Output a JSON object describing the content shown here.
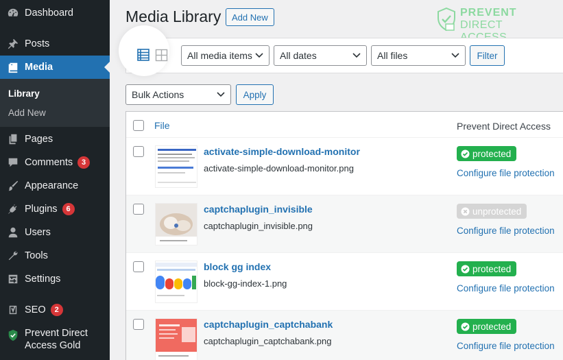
{
  "sidebar": {
    "items": [
      {
        "label": "Dashboard",
        "icon": "dashboard-icon"
      },
      {
        "label": "Posts",
        "icon": "pin-icon"
      },
      {
        "label": "Media",
        "icon": "media-icon",
        "active": true
      },
      {
        "label": "Pages",
        "icon": "pages-icon"
      },
      {
        "label": "Comments",
        "icon": "comment-icon",
        "badge": "3"
      },
      {
        "label": "Appearance",
        "icon": "brush-icon"
      },
      {
        "label": "Plugins",
        "icon": "plug-icon",
        "badge": "6"
      },
      {
        "label": "Users",
        "icon": "user-icon"
      },
      {
        "label": "Tools",
        "icon": "wrench-icon"
      },
      {
        "label": "Settings",
        "icon": "settings-icon"
      },
      {
        "label": "SEO",
        "icon": "yoast-icon",
        "badge": "2"
      },
      {
        "label_line1": "Prevent Direct",
        "label_line2": "Access Gold",
        "icon": "shield-icon"
      }
    ],
    "submenu": [
      {
        "label": "Library",
        "current": true
      },
      {
        "label": "Add New"
      }
    ]
  },
  "header": {
    "title": "Media Library",
    "add_new_label": "Add New",
    "brand_line1": "PREVENT",
    "brand_line2": "DIRECT ACCESS"
  },
  "filters": {
    "media_type": "All media items",
    "dates": "All dates",
    "files": "All files",
    "filter_button": "Filter",
    "bulk_actions": "Bulk Actions",
    "apply_button": "Apply"
  },
  "table": {
    "columns": {
      "file": "File",
      "pda": "Prevent Direct Access"
    },
    "rows": [
      {
        "title": "activate-simple-download-monitor",
        "filename": "activate-simple-download-monitor.png",
        "status": "protected",
        "link": "Configure file protection"
      },
      {
        "title": "captchaplugin_invisible",
        "filename": "captchaplugin_invisible.png",
        "status": "unprotected",
        "link": "Configure file protection"
      },
      {
        "title": "block gg index",
        "filename": "block-gg-index-1.png",
        "status": "protected",
        "link": "Configure file protection"
      },
      {
        "title": "captchaplugin_captchabank",
        "filename": "captchaplugin_captchabank.png",
        "status": "protected",
        "link": "Configure file protection"
      }
    ]
  },
  "colors": {
    "sidebar_bg": "#1d2327",
    "active_blue": "#2271b1",
    "protected_green": "#23b04e",
    "unprotected_gray": "#d5d5d5",
    "badge_red": "#d63638",
    "brand_green": "#8cd9a0"
  }
}
